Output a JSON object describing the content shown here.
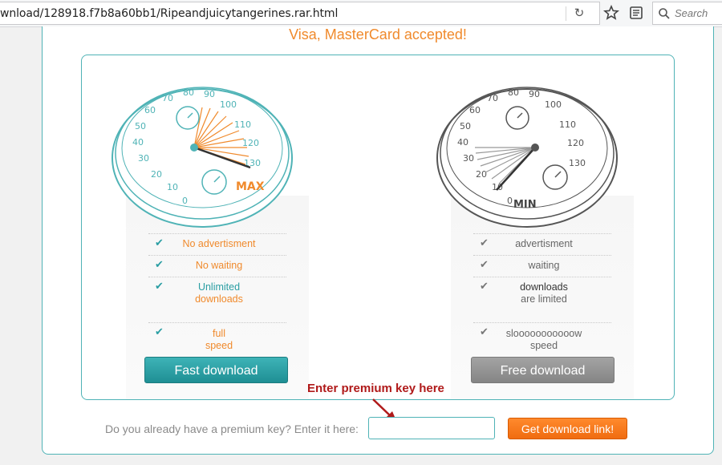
{
  "browser": {
    "url": "wnload/128918.f7b8a60bb1/Ripeandjuicytangerines.rar.html",
    "search_placeholder": "Search"
  },
  "page": {
    "accepted_text": "Visa, MasterCard accepted!",
    "fast": {
      "gauge_label": "MAX",
      "features": [
        {
          "lines": [
            "No advertisment"
          ]
        },
        {
          "lines": [
            "No waiting"
          ]
        },
        {
          "lines": [
            "Unlimited",
            "downloads"
          ]
        },
        {
          "lines": [
            "full",
            "speed"
          ]
        }
      ],
      "button": "Fast download"
    },
    "free": {
      "gauge_label": "MIN",
      "features": [
        {
          "lines": [
            "advertisment"
          ]
        },
        {
          "lines": [
            "waiting"
          ]
        },
        {
          "lines": [
            "downloads",
            "are limited"
          ]
        },
        {
          "lines": [
            "slooooooooooow",
            "speed"
          ]
        }
      ],
      "button": "Free download"
    },
    "gauge_ticks": [
      "0",
      "10",
      "20",
      "30",
      "40",
      "50",
      "60",
      "70",
      "80",
      "90",
      "100",
      "110",
      "120",
      "130"
    ],
    "annotation": "Enter premium key here",
    "premium_prompt": "Do you already have a premium key? Enter it here:",
    "premium_input_value": "",
    "get_link_button": "Get download link!",
    "colors": {
      "accent": "#4fb3b6",
      "orange": "#f08a2c",
      "annotation": "#b01a1a"
    }
  }
}
